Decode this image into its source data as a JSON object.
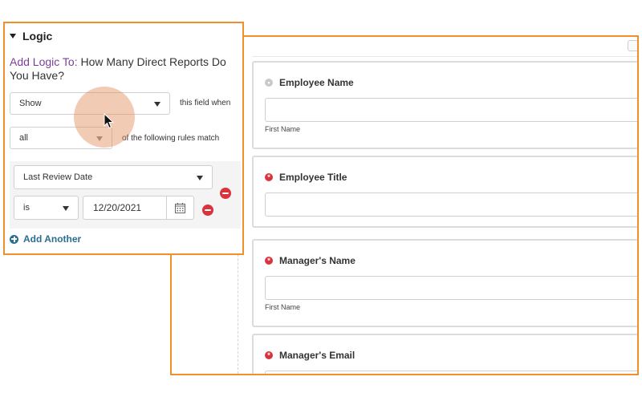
{
  "logic": {
    "header": "Logic",
    "title_prefix": "Add Logic To:",
    "title_field": "How Many Direct Reports Do You Have?",
    "action_select": "Show",
    "action_suffix": "this field when",
    "match_select": "all",
    "match_suffix": "of the following rules match",
    "rule": {
      "field_select": "Last Review Date",
      "operator_select": "is",
      "value": "12/20/2021"
    },
    "add_another": "Add Another"
  },
  "form": {
    "fields": [
      {
        "label": "Employee Name",
        "required": false,
        "sublabel": "First Name"
      },
      {
        "label": "Employee Title",
        "required": true,
        "sublabel": ""
      },
      {
        "label": "Manager's Name",
        "required": true,
        "sublabel": "First Name"
      },
      {
        "label": "Manager's Email",
        "required": true,
        "sublabel": ""
      }
    ]
  },
  "colors": {
    "panel_border": "#f0902a",
    "title_prefix": "#7b3f98",
    "required": "#d9343d",
    "link": "#2a6f8f"
  }
}
